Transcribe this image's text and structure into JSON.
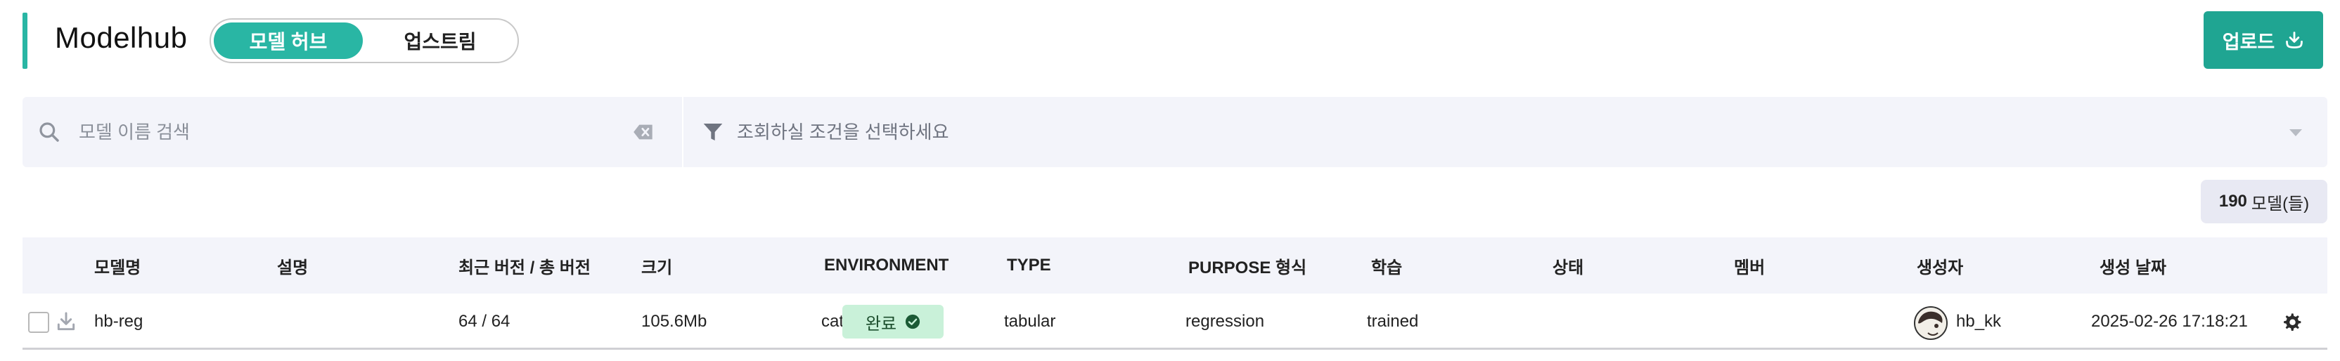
{
  "header": {
    "title": "Modelhub",
    "toggle": {
      "active_label": "모델 허브",
      "inactive_label": "업스트림"
    },
    "upload_label": "업로드"
  },
  "filters": {
    "search_placeholder": "모델 이름 검색",
    "condition_placeholder": "조회하실 조건을 선택하세요"
  },
  "count": {
    "value": "190",
    "unit": "모델(들)"
  },
  "table": {
    "columns": {
      "name": "모델명",
      "description": "설명",
      "version": "최근 버전 / 총 버전",
      "size": "크기",
      "environment": "ENVIRONMENT",
      "type": "TYPE",
      "purpose": "PURPOSE 형식",
      "training": "학습",
      "status": "상태",
      "member": "멤버",
      "creator": "생성자",
      "created": "생성 날짜"
    },
    "rows": [
      {
        "name": "hb-reg",
        "description": "",
        "version": "64 / 64",
        "size": "105.6Mb",
        "environment": "catboost",
        "type": "tabular",
        "purpose": "regression",
        "training": "trained",
        "status": "완료",
        "member": "",
        "creator": "hb_kk",
        "created": "2025-02-26 17:18:21"
      }
    ]
  },
  "colors": {
    "accent": "#29b6a4",
    "button": "#1fa592",
    "status_bg": "#c9f1d9",
    "panel_bg": "#f3f4fa"
  },
  "icons": [
    "search-icon",
    "clear-icon",
    "filter-icon",
    "chevron-down-icon",
    "upload-icon",
    "download-icon",
    "check-circle-icon",
    "gear-icon"
  ]
}
